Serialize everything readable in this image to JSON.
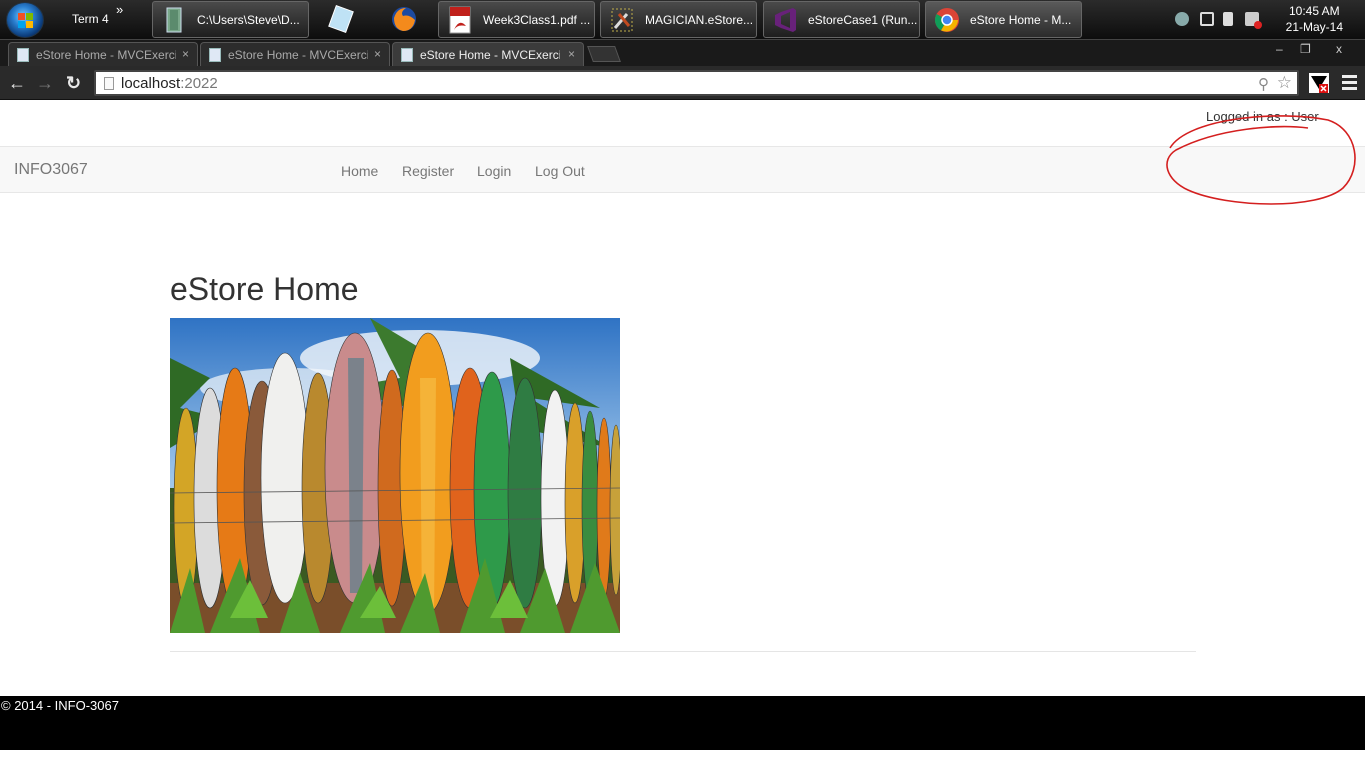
{
  "taskbar": {
    "toolbar_label": "Term 4",
    "overflow_glyph": "»",
    "buttons": [
      {
        "label": "C:\\Users\\Steve\\D...",
        "icon": "folder-icon"
      },
      {
        "label": "Week3Class1.pdf ...",
        "icon": "pdf-icon"
      },
      {
        "label": "MAGICIAN.eStore...",
        "icon": "tools-icon"
      },
      {
        "label": "eStoreCase1 (Run...",
        "icon": "visual-studio-icon"
      },
      {
        "label": "eStore Home - M...",
        "icon": "chrome-icon"
      }
    ],
    "clock_time": "10:45 AM",
    "clock_date": "21-May-14"
  },
  "browser": {
    "tabs": [
      {
        "title": "eStore Home - MVCExerci",
        "close": "×"
      },
      {
        "title": "eStore Home - MVCExerci",
        "close": "×"
      },
      {
        "title": "eStore Home - MVCExerci",
        "close": "×"
      }
    ],
    "window_controls": {
      "minimize": "–",
      "restore": "❐",
      "close": "x"
    },
    "nav": {
      "back": "←",
      "forward": "→",
      "reload": "↻"
    },
    "url_host": "localhost",
    "url_port": ":2022",
    "zoom_glyph": "⚲",
    "star_glyph": "☆"
  },
  "site": {
    "brand": "INFO3067",
    "nav_links": [
      "Home",
      "Register",
      "Login",
      "Log Out"
    ],
    "login_status": "Logged in as : User",
    "page_title": "eStore Home",
    "copyright": "© 2014 - INFO-3067"
  },
  "colors": {
    "annotation": "#d41f1f",
    "navbar_bg": "#f8f8f8",
    "footer_bg": "#000000"
  }
}
